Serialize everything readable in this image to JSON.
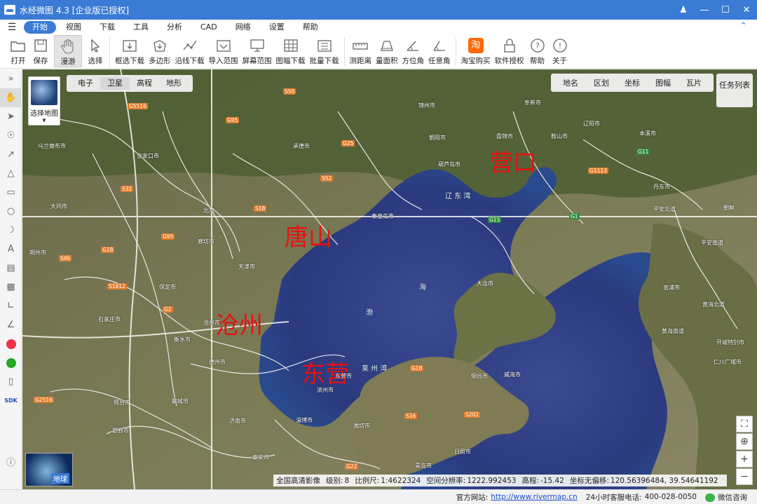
{
  "window": {
    "title": "水经微图 4.3 [企业版已授权]"
  },
  "menu": {
    "items": [
      "开始",
      "视图",
      "下载",
      "工具",
      "分析",
      "CAD",
      "网络",
      "设置",
      "帮助"
    ],
    "active": "开始"
  },
  "toolbar": {
    "items": [
      {
        "label": "打开",
        "icon": "folder-icon"
      },
      {
        "label": "保存",
        "icon": "save-icon"
      },
      {
        "label": "漫游",
        "icon": "hand-icon"
      },
      {
        "label": "选择",
        "icon": "pointer-icon"
      },
      {
        "label": "框选下载",
        "icon": "rect-download-icon"
      },
      {
        "label": "多边形",
        "icon": "polygon-download-icon"
      },
      {
        "label": "沿线下载",
        "icon": "line-download-icon"
      },
      {
        "label": "导入范围",
        "icon": "import-icon"
      },
      {
        "label": "屏幕范围",
        "icon": "screen-icon"
      },
      {
        "label": "图幅下载",
        "icon": "grid-icon"
      },
      {
        "label": "批量下载",
        "icon": "batch-icon"
      },
      {
        "label": "测距离",
        "icon": "ruler-icon"
      },
      {
        "label": "量面积",
        "icon": "area-icon"
      },
      {
        "label": "方位角",
        "icon": "azimuth-icon"
      },
      {
        "label": "任意角",
        "icon": "angle-icon"
      },
      {
        "label": "淘宝购买",
        "icon": "taobao-icon"
      },
      {
        "label": "软件授权",
        "icon": "lock-icon"
      },
      {
        "label": "帮助",
        "icon": "help-icon"
      },
      {
        "label": "关于",
        "icon": "info-icon"
      }
    ]
  },
  "map": {
    "select_map_label": "选择地图",
    "map_types": [
      "电子",
      "卫星",
      "高程",
      "地形"
    ],
    "active_type": "卫星",
    "layers": [
      "地名",
      "区划",
      "坐标",
      "图幅",
      "瓦片"
    ],
    "task_list": "任务列表",
    "globe_label": "地球",
    "annotations": [
      "唐山",
      "沧州",
      "东营",
      "营口"
    ],
    "sea_labels": [
      "辽 东 湾",
      "渤",
      "海",
      "莱 州 湾"
    ],
    "places": [
      "乌兰察布市",
      "张家口市",
      "大同市",
      "朔州市",
      "北京",
      "天津市",
      "保定市",
      "石家庄市",
      "衡水市",
      "德州市",
      "邢台市",
      "邯郸市",
      "聊城市",
      "济南市",
      "淄博市",
      "潍坊市",
      "青岛市",
      "烟台市",
      "威海市",
      "日照市",
      "泰安市",
      "秦皇岛市",
      "葫芦岛市",
      "锦州市",
      "盘锦市",
      "鞍山市",
      "辽阳市",
      "本溪市",
      "丹东市",
      "大连市",
      "承德市",
      "朝阳市",
      "平安北道",
      "平安南道",
      "南浦市",
      "黄海北道",
      "黄海南道",
      "开城特别市",
      "仁川广域市",
      "朝鲜",
      "滨州市",
      "东营市",
      "沧州市",
      "阜新市",
      "廊坊市",
      "德州",
      "阳泉市"
    ],
    "roads": [
      "G5516",
      "S50",
      "G95",
      "G25",
      "S32",
      "S52",
      "S18",
      "G95",
      "G18",
      "S1812",
      "G2",
      "S46",
      "G1",
      "G15",
      "G11",
      "G1113",
      "G18",
      "S16",
      "S202",
      "G22",
      "G2516"
    ],
    "status": {
      "source": "全国高清影像",
      "level_label": "级别:",
      "level": "8",
      "scale_label": "比例尺:",
      "scale": "1:4622324",
      "resolution_label": "空间分辨率:",
      "resolution": "1222.992453",
      "elevation_label": "高程:",
      "elevation": "-15.42",
      "coord_label": "坐标无偏移:",
      "coord": "120.56396484, 39.54641192"
    }
  },
  "statusbar": {
    "site_label": "官方网站:",
    "site_url": "http://www.rivermap.cn",
    "phone_label": "24小时客服电话:",
    "phone": "400-028-0050",
    "wechat": "微信咨询"
  },
  "left_tools": [
    "collapse-icon",
    "hand-icon",
    "pointer-icon",
    "pin-icon",
    "polyline-icon",
    "area-icon",
    "rectangle-icon",
    "circle-icon",
    "crescent-icon",
    "text-icon",
    "ruler-icon",
    "area-measure-icon",
    "azimuth-icon",
    "angle-icon",
    "weibo-icon",
    "green-icon",
    "device-icon",
    "sdk-label",
    "help-icon"
  ],
  "sdk_text": "SDK"
}
